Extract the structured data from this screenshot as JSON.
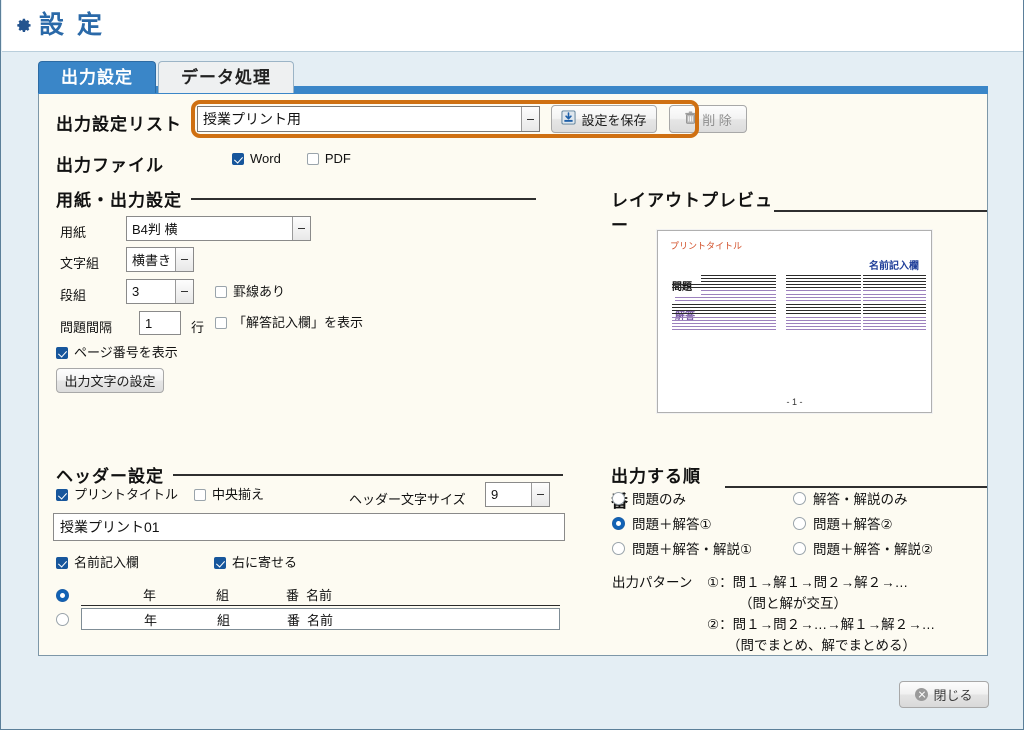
{
  "window": {
    "title": "設 定",
    "gear_icon": "gear-icon"
  },
  "tabs": [
    {
      "label": "出力設定",
      "active": true
    },
    {
      "label": "データ処理",
      "active": false
    }
  ],
  "top": {
    "list_label": "出力設定リスト",
    "list_value": "授業プリント用",
    "save_button": "設定を保存",
    "save_icon": "save-download-icon",
    "delete_button": "削 除",
    "delete_icon": "trash-icon",
    "file_label": "出力ファイル",
    "file_options": [
      {
        "label": "Word",
        "checked": true
      },
      {
        "label": "PDF",
        "checked": false
      }
    ]
  },
  "paper": {
    "section_title": "用紙・出力設定",
    "paper_label": "用紙",
    "paper_value": "B4判 横",
    "text_dir_label": "文字組",
    "text_dir_value": "横書き",
    "columns_label": "段組",
    "columns_value": "3",
    "ruled_label": "罫線あり",
    "ruled_checked": false,
    "spacing_label": "問題間隔",
    "spacing_value": "1",
    "spacing_unit": "行",
    "answer_field_label": "「解答記入欄」を表示",
    "answer_field_checked": false,
    "page_number_label": "ページ番号を表示",
    "page_number_checked": true,
    "output_char_button": "出力文字の設定"
  },
  "preview": {
    "section_title": "レイアウトプレビュー",
    "title_text": "プリントタイトル",
    "name_text": "名前記入欄",
    "question_text": "問題",
    "answer_text": "解答",
    "page_number": "- 1 -",
    "columns": 3,
    "title_color": "#d2502a",
    "name_color": "#21409a",
    "question_color": "#111111",
    "answer_color": "#7a5ba6"
  },
  "header": {
    "section_title": "ヘッダー設定",
    "print_title_label": "プリントタイトル",
    "print_title_checked": true,
    "center_label": "中央揃え",
    "center_checked": false,
    "font_size_label": "ヘッダー文字サイズ",
    "font_size_value": "9",
    "title_text_value": "授業プリント01",
    "name_field_label": "名前記入欄",
    "name_field_checked": true,
    "align_right_label": "右に寄せる",
    "align_right_checked": true,
    "name_styles": [
      {
        "selected": true,
        "year": "年",
        "class": "組",
        "number": "番",
        "name": "名前"
      },
      {
        "selected": false,
        "year": "年",
        "class": "組",
        "number": "番",
        "name": "名前"
      }
    ]
  },
  "order": {
    "section_title": "出力する順番",
    "options": [
      {
        "label": "問題のみ",
        "selected": false
      },
      {
        "label": "解答・解説のみ",
        "selected": false
      },
      {
        "label": "問題＋解答①",
        "selected": true
      },
      {
        "label": "問題＋解答②",
        "selected": false
      },
      {
        "label": "問題＋解答・解説①",
        "selected": false
      },
      {
        "label": "問題＋解答・解説②",
        "selected": false
      }
    ],
    "pattern_label": "出力パターン",
    "pattern_1": "①：問１→解１→問２→解２→…",
    "pattern_1_note": "（問と解が交互）",
    "pattern_2": "②：問１→問２→…→解１→解２→…",
    "pattern_2_note": "（問でまとめ、解でまとめる）"
  },
  "footer": {
    "close_button": "閉じる",
    "close_icon": "close-circle-icon"
  },
  "colors": {
    "accent_blue": "#3a86c8",
    "title_blue": "#2a69a8",
    "highlight_orange": "#cf7012",
    "panel_bg": "#fdfbf2",
    "window_bg": "#e4eef4",
    "checked_blue": "#17569c"
  }
}
